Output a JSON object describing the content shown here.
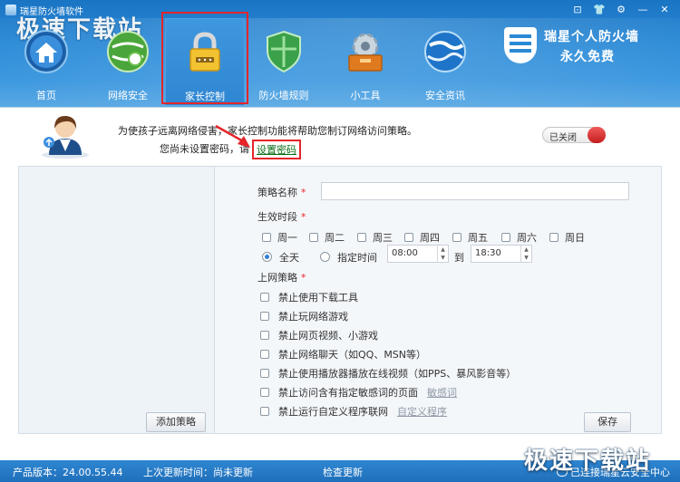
{
  "app": {
    "title": "瑞星防火墙软件",
    "watermark": "极速下载站"
  },
  "window_controls": [
    "⊡",
    "👕",
    "⚙",
    "—",
    "✕"
  ],
  "brand": {
    "line1": "瑞星个人防火墙",
    "line2": "永久免费"
  },
  "nav": [
    {
      "label": "首页",
      "icon": "home-icon"
    },
    {
      "label": "网络安全",
      "icon": "network-security-icon"
    },
    {
      "label": "家长控制",
      "icon": "padlock-icon",
      "active": true
    },
    {
      "label": "防火墙规则",
      "icon": "shield-icon"
    },
    {
      "label": "小工具",
      "icon": "gear-toolbox-icon"
    },
    {
      "label": "安全资讯",
      "icon": "globe-icon"
    }
  ],
  "parental": {
    "intro": "为使孩子远离网络侵害，家长控制功能将帮助您制订网络访问策略。",
    "no_password": "您尚未设置密码，请",
    "set_password": "设置密码",
    "toggle_label": "已关闭"
  },
  "left_panel": {
    "add_button": "添加策略"
  },
  "form": {
    "policy_name_label": "策略名称",
    "required_mark": "*",
    "effective_period_label": "生效时段",
    "days": [
      "周一",
      "周二",
      "周三",
      "周四",
      "周五",
      "周六",
      "周日"
    ],
    "all_day": "全天",
    "specified_time": "指定时间",
    "start_time": "08:00",
    "to": "到",
    "end_time": "18:30",
    "policy_label": "上网策略",
    "policies": [
      "禁止使用下载工具",
      "禁止玩网络游戏",
      "禁止网页视频、小游戏",
      "禁止网络聊天（如QQ、MSN等）",
      "禁止使用播放器播放在线视频（如PPS、暴风影音等）",
      "禁止访问含有指定敏感词的页面",
      "禁止运行自定义程序联网"
    ],
    "sensitive_words_link": "敏感词",
    "custom_program_link": "自定义程序",
    "save_button": "保存"
  },
  "status": {
    "version": "产品版本：24.00.55.44",
    "last_update": "上次更新时间：尚未更新",
    "check_update": "检查更新",
    "cloud": "已连接瑞星云安全中心"
  },
  "colors": {
    "top_blue": "#2b8ad6",
    "highlight_red": "#e5252a",
    "link_green": "#0b6e17",
    "status_blue": "#1f6fb9"
  }
}
